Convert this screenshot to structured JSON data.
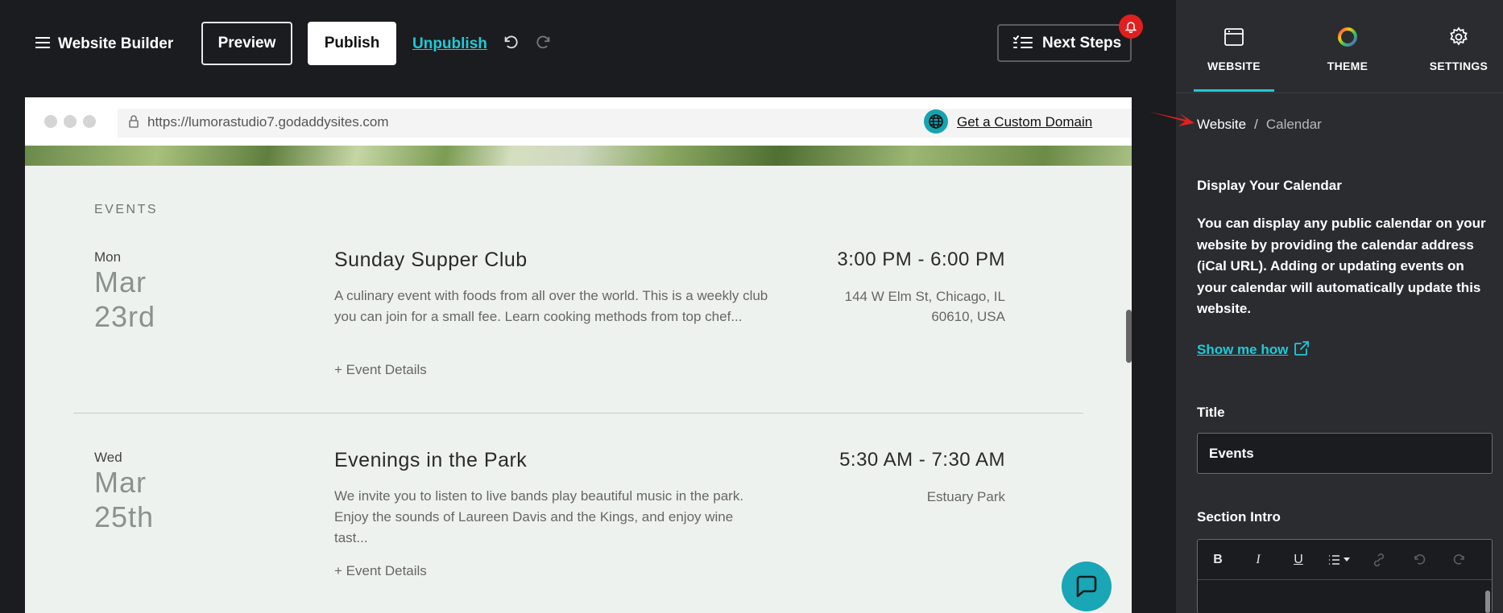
{
  "toolbar": {
    "app_title": "Website Builder",
    "preview_label": "Preview",
    "publish_label": "Publish",
    "unpublish_label": "Unpublish",
    "next_steps_label": "Next Steps"
  },
  "browser": {
    "url": "https://lumorastudio7.godaddysites.com",
    "custom_domain_label": "Get a Custom Domain"
  },
  "events_section": {
    "label": "EVENTS",
    "events": [
      {
        "day": "Mon",
        "month": "Mar",
        "date": "23rd",
        "title": "Sunday Supper Club",
        "description": "A culinary event with foods from all over the world. This is a weekly club you can join for a small fee. Learn cooking methods from top chef...",
        "details_label": "+ Event Details",
        "time": "3:00 PM - 6:00 PM",
        "location": "144 W Elm St, Chicago, IL 60610, USA"
      },
      {
        "day": "Wed",
        "month": "Mar",
        "date": "25th",
        "title": "Evenings in the Park",
        "description": "We invite you to listen to live bands play beautiful music in the park. Enjoy the sounds of Laureen Davis and the Kings, and enjoy wine tast...",
        "details_label": "+ Event Details",
        "time": "5:30 AM - 7:30 AM",
        "location": "Estuary Park"
      }
    ]
  },
  "panel": {
    "tabs": [
      {
        "label": "WEBSITE",
        "icon": "browser-window-icon",
        "active": true
      },
      {
        "label": "THEME",
        "icon": "color-wheel-icon",
        "active": false
      },
      {
        "label": "SETTINGS",
        "icon": "gear-icon",
        "active": false
      }
    ],
    "breadcrumb": {
      "root": "Website",
      "separator": "/",
      "current": "Calendar"
    },
    "display_title": "Display Your Calendar",
    "display_text": "You can display any public calendar on your website by providing the calendar address (iCal URL). Adding or updating events on your calendar will automatically update this website.",
    "show_me_how": "Show me how",
    "title_label": "Title",
    "title_value": "Events",
    "section_intro_label": "Section Intro",
    "rte_buttons": [
      "B",
      "I",
      "U",
      "list",
      "link",
      "undo",
      "redo"
    ]
  },
  "colors": {
    "accent": "#1fcad8",
    "badge": "#e0201f",
    "panel_bg": "#2b2c30",
    "toolbar_bg": "#1b1c1f",
    "site_bg": "#eef2ee"
  }
}
